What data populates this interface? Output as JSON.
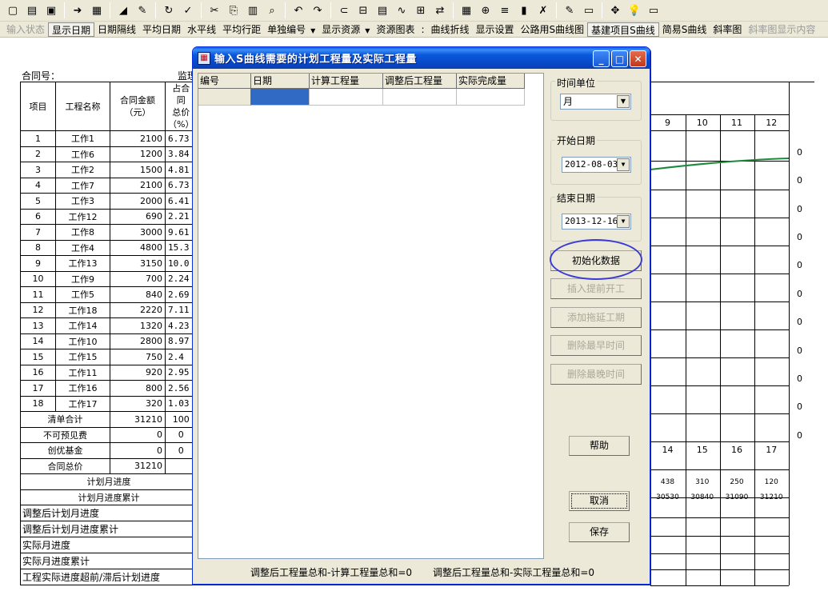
{
  "toolbar": {
    "icons": [
      "new-icon",
      "open-icon",
      "save-icon",
      "export-icon",
      "print-preview-icon",
      "triangle-icon",
      "pencil-icon",
      "refresh-icon",
      "check-icon",
      "cut-icon",
      "copy-icon",
      "paste-icon",
      "find-icon",
      "undo-icon",
      "redo-icon",
      "link-icon",
      "bar-icon",
      "schedule-icon",
      "curve-icon",
      "network-icon",
      "split-icon",
      "calendar-icon",
      "zoom-icon",
      "align-icon",
      "chart-icon",
      "tools-icon",
      "marker-icon",
      "monitor-icon",
      "move-icon",
      "bulb-icon",
      "export2-icon"
    ],
    "items": [
      {
        "label": "输入状态",
        "disabled": true
      },
      {
        "label": "显示日期",
        "pressed": true
      },
      {
        "label": "日期隔线"
      },
      {
        "label": "平均日期"
      },
      {
        "label": "水平线"
      },
      {
        "label": "平均行距"
      },
      {
        "label": "单独编号",
        "arrow": true
      },
      {
        "label": "显示资源",
        "arrow": true
      },
      {
        "label": "资源图表"
      },
      {
        "label": "曲线折线"
      },
      {
        "label": "显示设置"
      },
      {
        "label": "公路用S曲线图"
      },
      {
        "label": "基建项目S曲线",
        "pressed": true
      },
      {
        "label": "简易S曲线"
      },
      {
        "label": "斜率图"
      },
      {
        "label": "斜率图显示内容",
        "disabled": true
      }
    ]
  },
  "sheet": {
    "contract_label": "合同号：",
    "supervisor_label": "监理",
    "headers": {
      "item": "项目",
      "name": "工程名称",
      "amount": "合同金额\n（元）",
      "percent": "占合同\n总价\n（%）"
    },
    "rows": [
      {
        "no": "1",
        "name": "工作1",
        "amount": "2100",
        "pct": "6.73"
      },
      {
        "no": "2",
        "name": "工作6",
        "amount": "1200",
        "pct": "3.84"
      },
      {
        "no": "3",
        "name": "工作2",
        "amount": "1500",
        "pct": "4.81"
      },
      {
        "no": "4",
        "name": "工作7",
        "amount": "2100",
        "pct": "6.73"
      },
      {
        "no": "5",
        "name": "工作3",
        "amount": "2000",
        "pct": "6.41"
      },
      {
        "no": "6",
        "name": "工作12",
        "amount": "690",
        "pct": "2.21"
      },
      {
        "no": "7",
        "name": "工作8",
        "amount": "3000",
        "pct": "9.61"
      },
      {
        "no": "8",
        "name": "工作4",
        "amount": "4800",
        "pct": "15.3"
      },
      {
        "no": "9",
        "name": "工作13",
        "amount": "3150",
        "pct": "10.0"
      },
      {
        "no": "10",
        "name": "工作9",
        "amount": "700",
        "pct": "2.24"
      },
      {
        "no": "11",
        "name": "工作5",
        "amount": "840",
        "pct": "2.69"
      },
      {
        "no": "12",
        "name": "工作18",
        "amount": "2220",
        "pct": "7.11"
      },
      {
        "no": "13",
        "name": "工作14",
        "amount": "1320",
        "pct": "4.23"
      },
      {
        "no": "14",
        "name": "工作10",
        "amount": "2800",
        "pct": "8.97"
      },
      {
        "no": "15",
        "name": "工作15",
        "amount": "750",
        "pct": "2.4"
      },
      {
        "no": "16",
        "name": "工作11",
        "amount": "920",
        "pct": "2.95"
      },
      {
        "no": "17",
        "name": "工作16",
        "amount": "800",
        "pct": "2.56"
      },
      {
        "no": "18",
        "name": "工作17",
        "amount": "320",
        "pct": "1.03"
      }
    ],
    "totals": [
      {
        "label": "清单合计",
        "amount": "31210",
        "pct": "100"
      },
      {
        "label": "不可预见费",
        "amount": "0",
        "pct": "0"
      },
      {
        "label": "创优基金",
        "amount": "0",
        "pct": "0"
      },
      {
        "label": "合同总价",
        "amount": "31210",
        "pct": ""
      }
    ],
    "plan_rows": [
      "计划月进度",
      "计划月进度累计"
    ],
    "bottom_rows": [
      "调整后计划月进度",
      "调整后计划月进度累计",
      "实际月进度",
      "实际月进度累计",
      "工程实际进度超前/滞后计划进度"
    ],
    "months_top": [
      "9",
      "10",
      "11",
      "12"
    ],
    "months_bottom": [
      "14",
      "15",
      "16",
      "17"
    ],
    "plan_monthly": [
      "438",
      "310",
      "250",
      "120"
    ],
    "plan_cumulative": [
      "30530",
      "30840",
      "31090",
      "31210"
    ],
    "zeros": [
      "0",
      "0",
      "0",
      "0",
      "0",
      "0",
      "0",
      "0",
      "0",
      "0"
    ],
    "curve_color": "#1a8a3a"
  },
  "dialog": {
    "title": "输入S曲线需要的计划工程量及实际工程量",
    "columns": [
      "编号",
      "日期",
      "计算工程量",
      "调整后工程量",
      "实际完成量"
    ],
    "time_unit_label": "时间单位",
    "time_unit_value": "月",
    "start_label": "开始日期",
    "start_value": "2012-08-03",
    "end_label": "结束日期",
    "end_value": "2013-12-16",
    "buttons": {
      "init": "初始化数据",
      "insert_early": "插入提前开工",
      "add_delay": "添加拖延工期",
      "delete_earliest": "删除最早时间",
      "delete_latest": "删除最晚时间",
      "help": "帮助",
      "cancel": "取消",
      "save": "保存"
    },
    "status_left": "调整后工程量总和-计算工程量总和=0",
    "status_right": "调整后工程量总和-实际工程量总和=0",
    "accent": "#0a5fe3",
    "selection": "#316ac5",
    "annotation_circle": "#3a3ad6"
  }
}
